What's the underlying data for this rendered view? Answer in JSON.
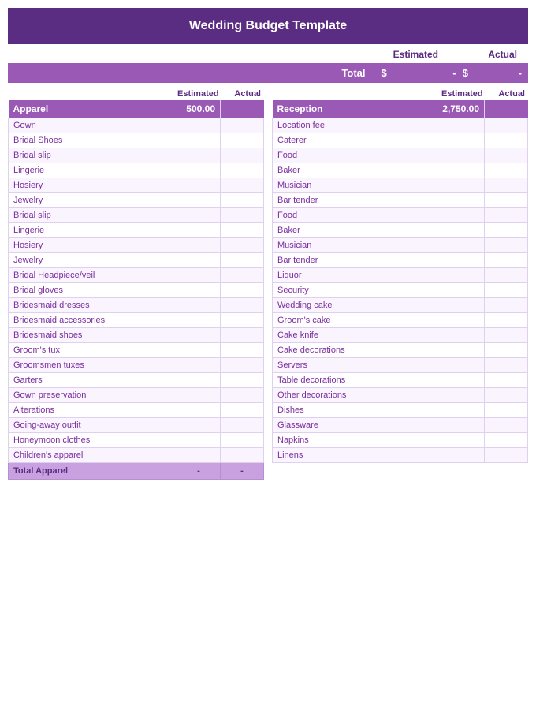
{
  "title": "Wedding Budget Template",
  "summary": {
    "estimated_label": "Estimated",
    "actual_label": "Actual"
  },
  "total_row": {
    "label": "Total",
    "dollar_sign": "$",
    "estimated_value": "-",
    "actual_dollar": "$",
    "actual_value": "-"
  },
  "left_table": {
    "col_estimated": "Estimated",
    "col_actual": "Actual",
    "category_label": "Apparel",
    "category_value": "500.00",
    "items": [
      "Gown",
      "Bridal Shoes",
      "Bridal slip",
      "Lingerie",
      "Hosiery",
      "Jewelry",
      "Bridal slip",
      "Lingerie",
      "Hosiery",
      "Jewelry",
      "Bridal Headpiece/veil",
      "Bridal gloves",
      "Bridesmaid dresses",
      "Bridesmaid accessories",
      "Bridesmaid shoes",
      "Groom's tux",
      "Groomsmen tuxes",
      "Garters",
      "Gown preservation",
      "Alterations",
      "Going-away outfit",
      "Honeymoon clothes",
      "Children's apparel"
    ],
    "total_label": "Total Apparel",
    "total_estimated": "-",
    "total_actual": "-"
  },
  "right_table": {
    "col_estimated": "Estimated",
    "col_actual": "Actual",
    "category_label": "Reception",
    "category_value": "2,750.00",
    "items": [
      "Location fee",
      "Caterer",
      "Food",
      "Baker",
      "Musician",
      "Bar tender",
      "Food",
      "Baker",
      "Musician",
      "Bar tender",
      "Liquor",
      "Security",
      "Wedding cake",
      "Groom's cake",
      "Cake knife",
      "Cake decorations",
      "Servers",
      "Table decorations",
      "Other decorations",
      "Dishes",
      "Glassware",
      "Napkins",
      "Linens"
    ]
  }
}
